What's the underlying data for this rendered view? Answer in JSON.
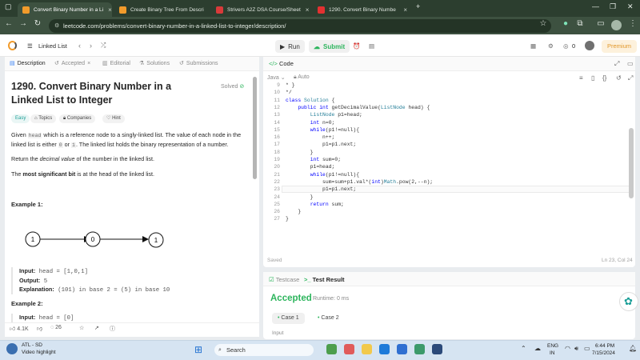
{
  "browser": {
    "tabs": [
      {
        "label": "Convert Binary Number in a Li",
        "color": "#f29b2b",
        "active": true
      },
      {
        "label": "Create Binary Tree From Descri",
        "color": "#f29b2b",
        "active": false
      },
      {
        "label": "Strivers A2Z DSA Course/Sheet",
        "color": "#d93a3a",
        "active": false
      },
      {
        "label": "1290. Convert Binary Numbe",
        "color": "#e33131",
        "active": false
      }
    ],
    "new_tab": "+",
    "url": "leetcode.com/problems/convert-binary-number-in-a-linked-list-to-integer/description/"
  },
  "header": {
    "list_label": "Linked List",
    "run": "Run",
    "submit": "Submit",
    "count": "0",
    "premium": "Premium"
  },
  "left": {
    "tabs": [
      "Description",
      "Accepted",
      "Editorial",
      "Solutions",
      "Submissions"
    ],
    "title": "1290. Convert Binary Number in a Linked List to Integer",
    "status": "Solved",
    "chips": [
      "Easy",
      "Topics",
      "Companies",
      "Hint"
    ],
    "desc1_a": "Given ",
    "desc1_code1": "head",
    "desc1_b": " which is a reference node to a singly-linked list. The value of each node in the linked list is either ",
    "desc1_code2": "0",
    "desc1_c": " or ",
    "desc1_code3": "1",
    "desc1_d": ". The linked list holds the binary representation of a number.",
    "desc2_a": "Return the ",
    "desc2_em": "decimal value",
    "desc2_b": " of the number in the linked list.",
    "desc3_a": "The ",
    "desc3_strong": "most significant bit",
    "desc3_b": " is at the head of the linked list.",
    "example1_title": "Example 1:",
    "diagram_nodes": [
      "1",
      "0",
      "1"
    ],
    "ex1_input_lbl": "Input:",
    "ex1_input": "head = [1,0,1]",
    "ex1_output_lbl": "Output:",
    "ex1_output": "5",
    "ex1_expl_lbl": "Explanation:",
    "ex1_expl": "(101) in base 2 = (5) in base 10",
    "example2_title": "Example 2:",
    "ex2_input_lbl": "Input:",
    "ex2_input": "head = [0]",
    "footer_likes": "4.1K",
    "footer_comments": "26"
  },
  "code": {
    "title": "Code",
    "language": "Java",
    "mode": "Auto",
    "line_numbers": [
      "9",
      "10",
      "11",
      "12",
      "13",
      "14",
      "15",
      "16",
      "17",
      "18",
      "19",
      "20",
      "21",
      "22",
      "23",
      "24",
      "25",
      "26",
      "27"
    ],
    "lines": [
      "* }",
      "*/",
      "class Solution {",
      "    public int getDecimalValue(ListNode head) {",
      "        ListNode p1=head;",
      "        int n=0;",
      "        while(p1!=null){",
      "            n++;",
      "            p1=p1.next;",
      "        }",
      "        int sum=0;",
      "        p1=head;",
      "        while(p1!=null){",
      "            sum=sum+p1.val*(int)Math.pow(2,--n);",
      "            p1=p1.next;",
      "        }",
      "        return sum;",
      "    }",
      "}"
    ],
    "saved": "Saved",
    "cursor": "Ln 23, Col 24"
  },
  "test": {
    "tab_testcase": "Testcase",
    "tab_result": "Test Result",
    "status": "Accepted",
    "runtime": "Runtime: 0 ms",
    "cases": [
      "Case 1",
      "Case 2"
    ],
    "input_label": "Input"
  },
  "taskbar": {
    "weather_temp": "ATL - SD",
    "weather_desc": "Video highlight",
    "search": "Search",
    "lang1": "ENG",
    "lang2": "IN",
    "time": "6:44 PM",
    "date": "7/15/2024"
  }
}
